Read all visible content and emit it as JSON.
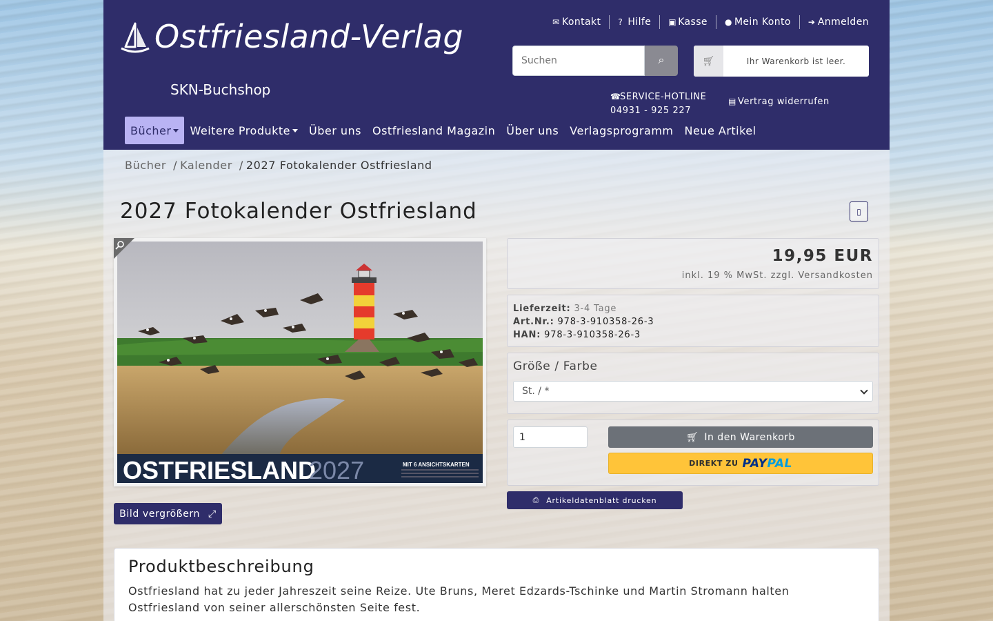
{
  "header": {
    "logo_title": "Ostfriesland-Verlag",
    "logo_subtitle": "SKN-Buchshop",
    "top_links": [
      {
        "icon": "envelope-icon",
        "label": "Kontakt"
      },
      {
        "icon": "question-icon",
        "label": "Hilfe"
      },
      {
        "icon": "cash-register-icon",
        "label": "Kasse"
      },
      {
        "icon": "user-icon",
        "label": "Mein Konto"
      },
      {
        "icon": "sign-in-icon",
        "label": "Anmelden"
      }
    ],
    "search_placeholder": "Suchen",
    "cart_text": "Ihr Warenkorb ist leer.",
    "hotline_label": "SERVICE-HOTLINE",
    "hotline_number": "04931 - 925 227",
    "widerruf_label": "Vertrag widerrufen",
    "nav": [
      {
        "label": "Bücher",
        "dropdown": true,
        "active": true
      },
      {
        "label": "Weitere Produkte",
        "dropdown": true,
        "active": false
      },
      {
        "label": "Über uns",
        "dropdown": false,
        "active": false
      },
      {
        "label": "Ostfriesland Magazin",
        "dropdown": false,
        "active": false
      },
      {
        "label": "Über uns",
        "dropdown": false,
        "active": false
      },
      {
        "label": "Verlagsprogramm",
        "dropdown": false,
        "active": false
      },
      {
        "label": "Neue Artikel",
        "dropdown": false,
        "active": false
      }
    ]
  },
  "breadcrumb": {
    "items": [
      "Bücher",
      "Kalender"
    ],
    "current": "2027 Fotokalender Ostfriesland"
  },
  "product": {
    "title": "2027 Fotokalender Ostfriesland",
    "cover_title": "OSTFRIESLAND",
    "cover_year": "2027",
    "cover_badge": "MIT 6 ANSICHTSKARTEN",
    "zoom_button": "Bild vergrößern",
    "price": "19,95 EUR",
    "vat_note": "inkl. 19 % MwSt. zzgl. Versandkosten",
    "delivery_label": "Lieferzeit:",
    "delivery_value": "3-4 Tage",
    "artnr_label": "Art.Nr.:",
    "artnr_value": "978-3-910358-26-3",
    "han_label": "HAN:",
    "han_value": "978-3-910358-26-3",
    "variant_label": "Größe / Farbe",
    "variant_selected": "St. / *",
    "quantity": "1",
    "cart_button": "In den Warenkorb",
    "paypal_prefix": "DIREKT ZU",
    "paypal_brand_1": "PAY",
    "paypal_brand_2": "PAL",
    "print_button": "Artikeldatenblatt drucken"
  },
  "description": {
    "heading": "Produktbeschreibung",
    "text": "Ostfriesland hat zu jeder Jahreszeit seine Reize. Ute Bruns, Meret Edzards-Tschinke und Martin Stromann halten Ostfriesland von seiner allerschönsten Seite fest."
  },
  "colors": {
    "brand": "#2f2d6a",
    "nav_active": "#b9b3f3",
    "paypal": "#ffc439"
  }
}
